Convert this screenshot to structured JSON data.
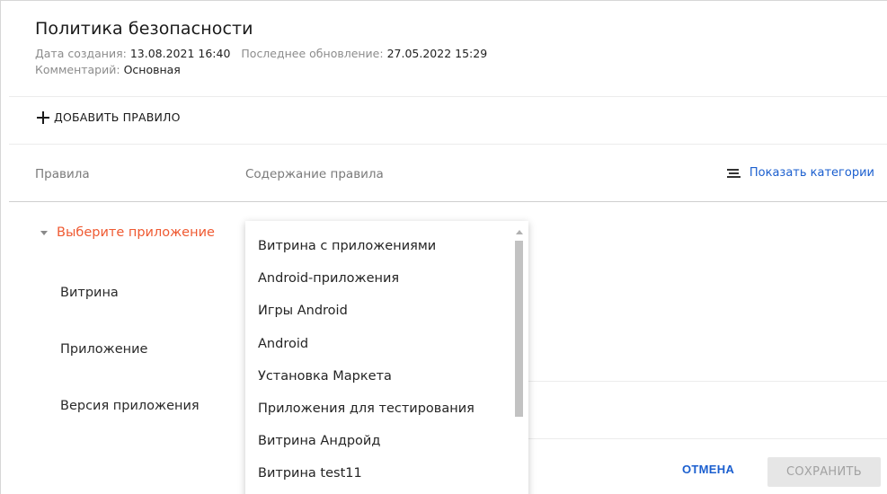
{
  "policy": {
    "title": "Политика безопасности",
    "created_label": "Дата создания:",
    "created_value": "13.08.2021 16:40",
    "updated_label": "Последнее обновление:",
    "updated_value": "27.05.2022 15:29",
    "comment_label": "Комментарий:",
    "comment_value": "Основная"
  },
  "toolbar": {
    "add_rule_label": "ДОБАВИТЬ ПРАВИЛО",
    "add_rule_icon": "plus-icon"
  },
  "table": {
    "col_rules": "Правила",
    "col_content": "Содержание правила",
    "show_categories_label": "Показать категории",
    "show_categories_icon": "list-lines-icon"
  },
  "rule": {
    "select_app_label": "Выберите приложение",
    "fields": [
      "Витрина",
      "Приложение",
      "Версия приложения"
    ]
  },
  "dropdown": {
    "options": [
      "Витрина с приложениями",
      "Android-приложения",
      "Игры Android",
      "Android",
      "Установка Маркета",
      "Приложения для тестирования",
      "Витрина Андройд",
      "Витрина test11"
    ]
  },
  "footer": {
    "cancel_label": "ОТМЕНА",
    "save_label": "СОХРАНИТЬ"
  },
  "colors": {
    "accent_blue": "#1b5fcf",
    "warning_orange": "#ef5a32",
    "disabled_bg": "#e6e6e6"
  }
}
